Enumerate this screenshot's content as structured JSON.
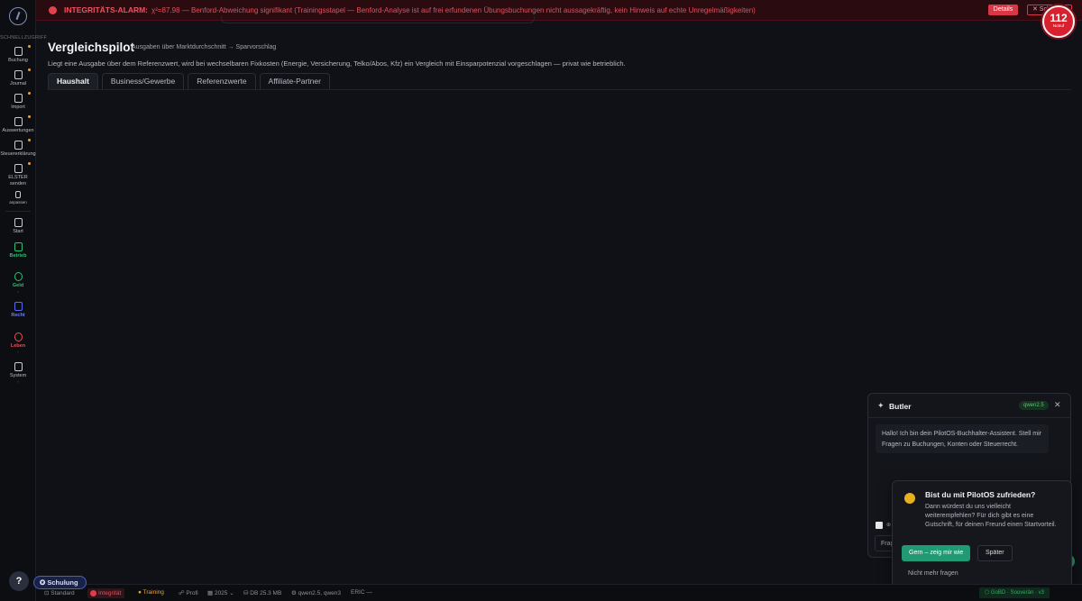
{
  "sidebar": {
    "quick_label": "SCHNELLZUGRIFF",
    "items": [
      {
        "label": "Buchung",
        "icon": "document-icon",
        "badge": true
      },
      {
        "label": "Journal",
        "icon": "journal-icon",
        "badge": true
      },
      {
        "label": "Import",
        "icon": "upload-icon",
        "badge": true
      },
      {
        "label": "Auswertungen",
        "icon": "chart-icon",
        "badge": true
      },
      {
        "label": "Steuererklärung",
        "icon": "tax-file-icon",
        "badge": true
      },
      {
        "label": "ELSTER senden",
        "icon": "send-icon",
        "badge": true
      },
      {
        "label": "anpassen",
        "icon": "pencil-icon",
        "badge": false
      }
    ],
    "sections": [
      {
        "label": "Start",
        "icon": "home-icon",
        "color": "#c9ccd4"
      },
      {
        "label": "Betrieb",
        "icon": "briefcase-icon",
        "color": "#2fbf71"
      },
      {
        "label": "Geld",
        "icon": "piggy-bank-icon",
        "color": "#2fbf71"
      },
      {
        "label": "Recht",
        "icon": "scales-icon",
        "color": "#5b6cf0"
      },
      {
        "label": "Leben",
        "icon": "heart-pulse-icon",
        "color": "#e8505b"
      },
      {
        "label": "System",
        "icon": "grid-icon",
        "color": "#c9ccd4"
      }
    ]
  },
  "alarm": {
    "title": "INTEGRITÄTS-ALARM:",
    "text": "χ²=87.98 — Benford-Abweichung signifikant (Trainingsstapel — Benford-Analyse ist auf frei erfundenen Übungsbuchungen nicht aussagekräftig, kein Hinweis auf echte Unregelmäßigkeiten)",
    "details_label": "Details",
    "close_label": "✕ Schließen",
    "color": "#e2414f"
  },
  "emergency": {
    "number": "112",
    "caption": "Notruf"
  },
  "page": {
    "title": "Vergleichspilot",
    "subtitle": "Ausgaben über Marktdurchschnitt → Sparvorschlag",
    "description": "Liegt eine Ausgabe über dem Referenzwert, wird bei wechselbaren Fixkosten (Energie, Versicherung, Telko/Abos, Kfz) ein Vergleich mit Einsparpotenzial vorgeschlagen — privat wie betrieblich.",
    "tabs": [
      "Haushalt",
      "Business/Gewerbe",
      "Referenzwerte",
      "Affiliate-Partner"
    ],
    "active_tab": "Haushalt"
  },
  "butler": {
    "title": "Butler",
    "model": "qwen2.5",
    "greeting": "Hallo! Ich bin dein PilotOS-Buchhalter-Assistent. Stell mir Fragen zu Buchungen, Konten oder Steuerrecht.",
    "checkbox_label": "⊕",
    "input_placeholder": "Frage"
  },
  "feedback": {
    "title": "Bist du mit PilotOS zufrieden?",
    "text": "Dann würdest du uns vielleicht weiterempfehlen? Für dich gibt es eine Gutschrift, für deinen Freund einen Startvorteil.",
    "yes_label": "Gern – zeig mir wie",
    "later_label": "Später",
    "never_label": "Nicht mehr fragen"
  },
  "help_label": "?",
  "schulung_label": "✪ Schulung",
  "statusbar": {
    "mode": "⊡ Standard",
    "integrity": "Integrität",
    "training": "Training",
    "profile": "Profi",
    "year": "2025",
    "db": "DB 25.3 MB",
    "models": "qwen2.5, qwen3",
    "eric": "ERIC —",
    "right": "⬡ GoBD · Souverän · v3"
  }
}
